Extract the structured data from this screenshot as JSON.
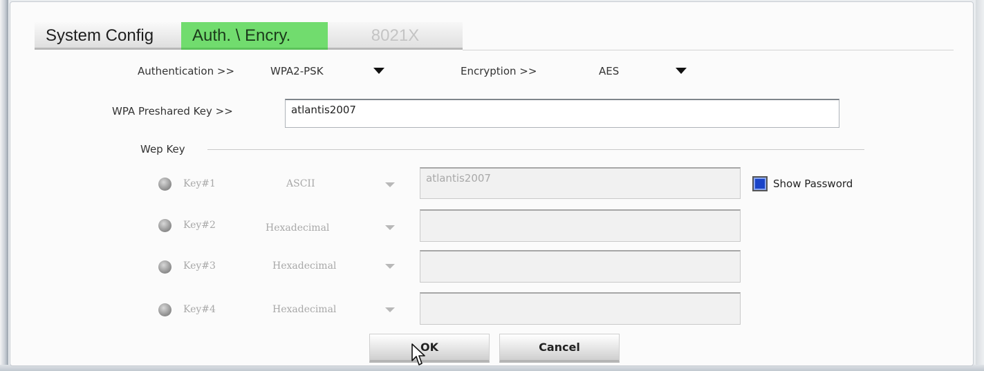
{
  "tabs": {
    "system_config": "System Config",
    "auth_encry": "Auth. \\ Encry.",
    "x8021": "8021X"
  },
  "auth": {
    "authentication_label": "Authentication >>",
    "authentication_value": "WPA2-PSK",
    "encryption_label": "Encryption >>",
    "encryption_value": "AES"
  },
  "wpa": {
    "label": "WPA Preshared Key >>",
    "value": "atlantis2007"
  },
  "wep": {
    "section_label": "Wep Key",
    "keys": [
      {
        "label": "Key#1",
        "format": "ASCII",
        "value": "atlantis2007"
      },
      {
        "label": "Key#2",
        "format": "Hexadecimal",
        "value": ""
      },
      {
        "label": "Key#3",
        "format": "Hexadecimal",
        "value": ""
      },
      {
        "label": "Key#4",
        "format": "Hexadecimal",
        "value": ""
      }
    ],
    "show_password_label": "Show Password",
    "show_password_checked": true
  },
  "buttons": {
    "ok": "OK",
    "cancel": "Cancel"
  },
  "colors": {
    "active_tab": "#71dc6e",
    "checkbox": "#1a44c8"
  },
  "icons": [
    "dropdown-arrow-icon",
    "radio-icon",
    "mouse-cursor-icon"
  ]
}
